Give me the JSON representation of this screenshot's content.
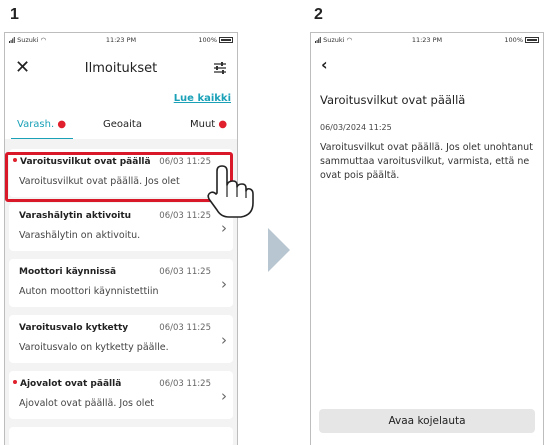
{
  "steps": [
    "1",
    "2"
  ],
  "status_bar": {
    "carrier": "Suzuki",
    "time": "11:23 PM",
    "battery": "100%"
  },
  "screen1": {
    "title": "Ilmoitukset",
    "close_icon": "close-icon",
    "filter_icon": "filter-sliders-icon",
    "mark_all_read": "Lue kaikki",
    "tabs": [
      {
        "label": "Varash.",
        "active": true,
        "badge": true
      },
      {
        "label": "Geoaita",
        "active": false,
        "badge": false
      },
      {
        "label": "Muut",
        "active": false,
        "badge": true
      }
    ],
    "notifications": [
      {
        "title": "Varoitusvilkut ovat päällä",
        "date": "06/03 11:25",
        "body": "Varoitusvilkut ovat päällä. Jos olet",
        "unread": true,
        "highlighted": true
      },
      {
        "title": "Varashälytin aktivoitu",
        "date": "06/03 11:25",
        "body": "Varashälytin on aktivoitu.",
        "unread": false
      },
      {
        "title": "Moottori käynnissä",
        "date": "06/03 11:25",
        "body": "Auton moottori käynnistettiin",
        "unread": false
      },
      {
        "title": "Varoitusvalo kytketty",
        "date": "06/03 11:25",
        "body": "Varoitusvalo on kytketty päälle.",
        "unread": false
      },
      {
        "title": "Ajovalot ovat päällä",
        "date": "06/03 11:25",
        "body": "Ajovalot ovat päällä. Jos olet",
        "unread": true
      }
    ],
    "accent_color": "#1aa1b8",
    "highlight_color": "#d9182a"
  },
  "screen2": {
    "back_icon": "back-chevron-icon",
    "title": "Varoitusvilkut ovat päällä",
    "date": "06/03/2024 11:25",
    "body": "Varoitusvilkut ovat päällä. Jos olet unohtanut sammuttaa varoitusvilkut, varmista, että ne ovat pois päältä.",
    "button_label": "Avaa kojelauta"
  }
}
